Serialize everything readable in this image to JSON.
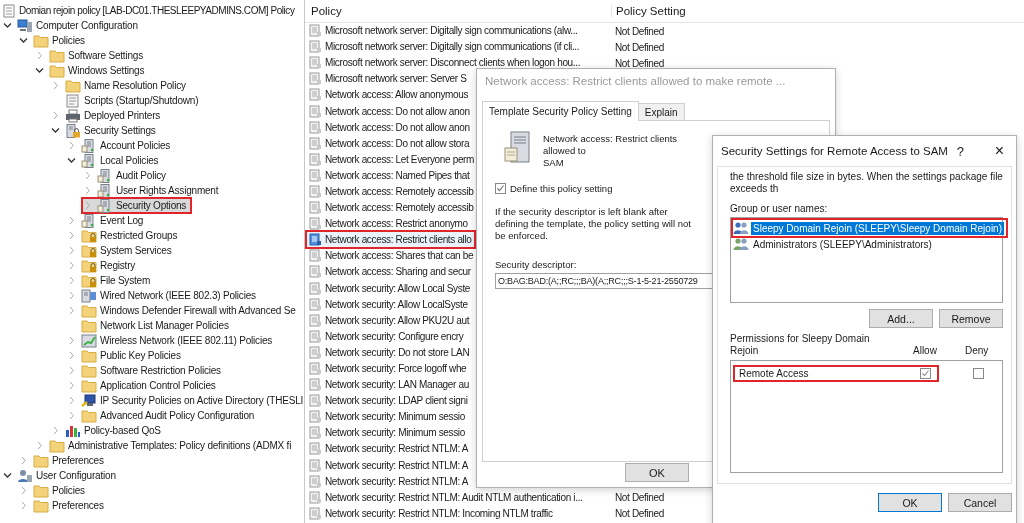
{
  "tree": {
    "root": {
      "label": "Domian rejoin policy [LAB-DC01.THESLEEPYADMINS.COM] Policy",
      "kind": "gpo"
    },
    "items": [
      {
        "label": "Computer Configuration",
        "kind": "computer",
        "expanded": true,
        "selected": false,
        "highlighted": false,
        "children": [
          {
            "label": "Policies",
            "kind": "folder",
            "expanded": true,
            "selected": false,
            "highlighted": false,
            "children": [
              {
                "label": "Software Settings",
                "kind": "folder",
                "expanded": false,
                "selected": false,
                "highlighted": false
              },
              {
                "label": "Windows Settings",
                "kind": "folder",
                "expanded": true,
                "selected": false,
                "highlighted": false,
                "children": [
                  {
                    "label": "Name Resolution Policy",
                    "kind": "folder",
                    "expanded": false,
                    "selected": false,
                    "highlighted": false
                  },
                  {
                    "label": "Scripts (Startup/Shutdown)",
                    "kind": "scripts",
                    "selected": false,
                    "highlighted": false
                  },
                  {
                    "label": "Deployed Printers",
                    "kind": "printer",
                    "expanded": false,
                    "selected": false,
                    "highlighted": false
                  },
                  {
                    "label": "Security Settings",
                    "kind": "security",
                    "expanded": true,
                    "selected": false,
                    "highlighted": false,
                    "children": [
                      {
                        "label": "Account Policies",
                        "kind": "policy",
                        "expanded": false,
                        "selected": false,
                        "highlighted": false
                      },
                      {
                        "label": "Local Policies",
                        "kind": "policy",
                        "expanded": true,
                        "selected": false,
                        "highlighted": false,
                        "children": [
                          {
                            "label": "Audit Policy",
                            "kind": "policy",
                            "expanded": false,
                            "selected": false,
                            "highlighted": false
                          },
                          {
                            "label": "User Rights Assignment",
                            "kind": "policy",
                            "expanded": false,
                            "selected": false,
                            "highlighted": false
                          },
                          {
                            "label": "Security Options",
                            "kind": "policy",
                            "expanded": false,
                            "selected": true,
                            "highlighted": true
                          }
                        ]
                      },
                      {
                        "label": "Event Log",
                        "kind": "policy",
                        "expanded": false,
                        "selected": false,
                        "highlighted": false
                      },
                      {
                        "label": "Restricted Groups",
                        "kind": "lockfolder",
                        "expanded": false,
                        "selected": false,
                        "highlighted": false
                      },
                      {
                        "label": "System Services",
                        "kind": "lockfolder",
                        "expanded": false,
                        "selected": false,
                        "highlighted": false
                      },
                      {
                        "label": "Registry",
                        "kind": "lockfolder",
                        "expanded": false,
                        "selected": false,
                        "highlighted": false
                      },
                      {
                        "label": "File System",
                        "kind": "lockfolder",
                        "expanded": false,
                        "selected": false,
                        "highlighted": false
                      },
                      {
                        "label": "Wired Network (IEEE 802.3) Policies",
                        "kind": "wired",
                        "expanded": false,
                        "selected": false,
                        "highlighted": false
                      },
                      {
                        "label": "Windows Defender Firewall with Advanced Se",
                        "kind": "folder",
                        "expanded": false,
                        "selected": false,
                        "highlighted": false
                      },
                      {
                        "label": "Network List Manager Policies",
                        "kind": "folder",
                        "selected": false,
                        "highlighted": false
                      },
                      {
                        "label": "Wireless Network (IEEE 802.11) Policies",
                        "kind": "wireless",
                        "expanded": false,
                        "selected": false,
                        "highlighted": false
                      },
                      {
                        "label": "Public Key Policies",
                        "kind": "folder",
                        "expanded": false,
                        "selected": false,
                        "highlighted": false
                      },
                      {
                        "label": "Software Restriction Policies",
                        "kind": "folder",
                        "expanded": false,
                        "selected": false,
                        "highlighted": false
                      },
                      {
                        "label": "Application Control Policies",
                        "kind": "folder",
                        "expanded": false,
                        "selected": false,
                        "highlighted": false
                      },
                      {
                        "label": "IP Security Policies on Active Directory (THESLI",
                        "kind": "ipsec",
                        "expanded": false,
                        "selected": false,
                        "highlighted": false
                      },
                      {
                        "label": "Advanced Audit Policy Configuration",
                        "kind": "folder",
                        "expanded": false,
                        "selected": false,
                        "highlighted": false
                      }
                    ]
                  },
                  {
                    "label": "Policy-based QoS",
                    "kind": "qos",
                    "expanded": false,
                    "selected": false,
                    "highlighted": false
                  }
                ]
              },
              {
                "label": "Administrative Templates: Policy definitions (ADMX fi",
                "kind": "folder",
                "expanded": false,
                "selected": false,
                "highlighted": false
              }
            ]
          },
          {
            "label": "Preferences",
            "kind": "folder",
            "expanded": false,
            "selected": false,
            "highlighted": false
          }
        ]
      },
      {
        "label": "User Configuration",
        "kind": "user",
        "expanded": true,
        "selected": false,
        "highlighted": false,
        "children": [
          {
            "label": "Policies",
            "kind": "folder",
            "expanded": false,
            "selected": false,
            "highlighted": false
          },
          {
            "label": "Preferences",
            "kind": "folder",
            "expanded": false,
            "selected": false,
            "highlighted": false
          }
        ]
      }
    ]
  },
  "list": {
    "columns": [
      "Policy",
      "Policy Setting"
    ],
    "rows": [
      {
        "policy": "Microsoft network server: Digitally sign communications (alw...",
        "setting": "Not Defined",
        "selected": false,
        "highlighted": false
      },
      {
        "policy": "Microsoft network server: Digitally sign communications (if cli...",
        "setting": "Not Defined",
        "selected": false,
        "highlighted": false
      },
      {
        "policy": "Microsoft network server: Disconnect clients when logon hou...",
        "setting": "Not Defined",
        "selected": false,
        "highlighted": false
      },
      {
        "policy": "Microsoft network server: Server S",
        "selected": false,
        "highlighted": false
      },
      {
        "policy": "Network access: Allow anonymous",
        "selected": false,
        "highlighted": false
      },
      {
        "policy": "Network access: Do not allow anon",
        "selected": false,
        "highlighted": false
      },
      {
        "policy": "Network access: Do not allow anon",
        "selected": false,
        "highlighted": false
      },
      {
        "policy": "Network access: Do not allow stora",
        "selected": false,
        "highlighted": false
      },
      {
        "policy": "Network access: Let Everyone perm",
        "selected": false,
        "highlighted": false
      },
      {
        "policy": "Network access: Named Pipes that",
        "selected": false,
        "highlighted": false
      },
      {
        "policy": "Network access: Remotely accessib",
        "selected": false,
        "highlighted": false
      },
      {
        "policy": "Network access: Remotely accessib",
        "selected": false,
        "highlighted": false
      },
      {
        "policy": "Network access: Restrict anonymo",
        "selected": false,
        "highlighted": false
      },
      {
        "policy": "Network access: Restrict clients allo",
        "selected": true,
        "highlighted": true
      },
      {
        "policy": "Network access: Shares that can be",
        "selected": false,
        "highlighted": false
      },
      {
        "policy": "Network access: Sharing and secur",
        "selected": false,
        "highlighted": false
      },
      {
        "policy": "Network security: Allow Local Syste",
        "selected": false,
        "highlighted": false
      },
      {
        "policy": "Network security: Allow LocalSyste",
        "selected": false,
        "highlighted": false
      },
      {
        "policy": "Network security: Allow PKU2U aut",
        "selected": false,
        "highlighted": false
      },
      {
        "policy": "Network security: Configure encry",
        "selected": false,
        "highlighted": false
      },
      {
        "policy": "Network security: Do not store LAN",
        "selected": false,
        "highlighted": false
      },
      {
        "policy": "Network security: Force logoff whe",
        "selected": false,
        "highlighted": false
      },
      {
        "policy": "Network security: LAN Manager au",
        "selected": false,
        "highlighted": false
      },
      {
        "policy": "Network security: LDAP client signi",
        "selected": false,
        "highlighted": false
      },
      {
        "policy": "Network security: Minimum sessio",
        "selected": false,
        "highlighted": false
      },
      {
        "policy": "Network security: Minimum sessio",
        "selected": false,
        "highlighted": false
      },
      {
        "policy": "Network security: Restrict NTLM: A",
        "selected": false,
        "highlighted": false
      },
      {
        "policy": "Network security: Restrict NTLM: A",
        "selected": false,
        "highlighted": false
      },
      {
        "policy": "Network security: Restrict NTLM: A",
        "selected": false,
        "highlighted": false
      },
      {
        "policy": "Network security: Restrict NTLM: Audit NTLM authentication i...",
        "setting": "Not Defined",
        "selected": false,
        "highlighted": false
      },
      {
        "policy": "Network security: Restrict NTLM: Incoming NTLM traffic",
        "setting": "Not Defined",
        "selected": false,
        "highlighted": false
      }
    ]
  },
  "policy_dialog": {
    "title": "Network access: Restrict clients allowed to make remote ...",
    "tabs": [
      {
        "label": "Template Security Policy Setting",
        "selected": true
      },
      {
        "label": "Explain",
        "selected": false
      }
    ],
    "heading_lines": [
      "Network access: Restrict clients allowed to",
      "SAM"
    ],
    "define": {
      "label": "Define this policy setting",
      "checked": true
    },
    "note": "If the security descriptor is left blank after defining the template, the policy setting will not be enforced.",
    "descriptor_label": "Security descriptor:",
    "descriptor_value": "O:BAG:BAD:(A;;RC;;;BA)(A;;RC;;;S-1-5-21-2550729",
    "buttons": [
      "OK"
    ]
  },
  "security_dialog": {
    "title": "Security Settings for Remote Access to SAM",
    "help": "?",
    "close": "×",
    "description": "the threshold file size in bytes. When the settings package file exceeds th",
    "groups_label": "Group or user names:",
    "groups": [
      {
        "name": "Sleepy Domain Rejoin (SLEEPY\\Sleepy Domain Rejoin)",
        "selected": true,
        "highlighted": true
      },
      {
        "name": "Administrators (SLEEPY\\Administrators)",
        "selected": false,
        "highlighted": false
      }
    ],
    "group_buttons": [
      "Add...",
      "Remove"
    ],
    "permissions_label": "Permissions for Sleepy Domain Rejoin",
    "columns": [
      "Allow",
      "Deny"
    ],
    "permissions": [
      {
        "name": "Remote Access",
        "allow": true,
        "deny": false,
        "highlighted": true
      }
    ],
    "buttons": [
      {
        "label": "OK",
        "default": true
      },
      {
        "label": "Cancel",
        "default": false
      }
    ]
  }
}
